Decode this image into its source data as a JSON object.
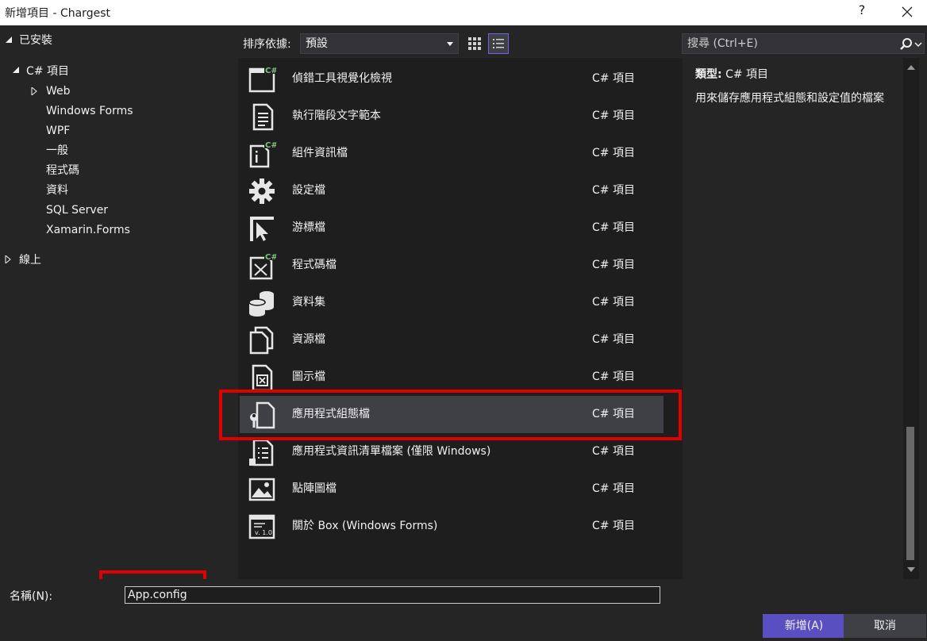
{
  "window": {
    "title": "新增項目 - Chargest",
    "help": "?"
  },
  "tree": {
    "installed": "已安裝",
    "csharp": "C# 項目",
    "children": [
      "Web",
      "Windows Forms",
      "WPF",
      "一般",
      "程式碼",
      "資料",
      "SQL Server",
      "Xamarin.Forms"
    ],
    "online": "線上"
  },
  "toolbar": {
    "sort_label": "排序依據:",
    "sort_value": "預設"
  },
  "search": {
    "placeholder": "搜尋 (Ctrl+E)"
  },
  "items": [
    {
      "name": "偵錯工具視覺化檢視",
      "type": "C# 項目",
      "icon": "visualizer-icon"
    },
    {
      "name": "執行階段文字範本",
      "type": "C# 項目",
      "icon": "text-template-icon"
    },
    {
      "name": "組件資訊檔",
      "type": "C# 項目",
      "icon": "assembly-info-icon"
    },
    {
      "name": "設定檔",
      "type": "C# 項目",
      "icon": "settings-gear-icon"
    },
    {
      "name": "游標檔",
      "type": "C# 項目",
      "icon": "cursor-icon"
    },
    {
      "name": "程式碼檔",
      "type": "C# 項目",
      "icon": "code-file-icon"
    },
    {
      "name": "資料集",
      "type": "C# 項目",
      "icon": "dataset-icon"
    },
    {
      "name": "資源檔",
      "type": "C# 項目",
      "icon": "resource-file-icon"
    },
    {
      "name": "圖示檔",
      "type": "C# 項目",
      "icon": "icon-file-icon"
    },
    {
      "name": "應用程式組態檔",
      "type": "C# 項目",
      "icon": "app-config-icon"
    },
    {
      "name": "應用程式資訊清單檔案 (僅限 Windows)",
      "type": "C# 項目",
      "icon": "manifest-icon"
    },
    {
      "name": "點陣圖檔",
      "type": "C# 項目",
      "icon": "bitmap-icon"
    },
    {
      "name": "關於 Box (Windows Forms)",
      "type": "C# 項目",
      "icon": "about-box-icon"
    }
  ],
  "selected_index": 9,
  "description": {
    "type_label": "類型:",
    "type_value": "C# 項目",
    "text": "用來儲存應用程式組態和設定值的檔案"
  },
  "footer": {
    "name_label": "名稱(N):",
    "name_value": "App.config",
    "add_button": "新增(A)",
    "cancel_button": "取消"
  },
  "colors": {
    "accent": "#5a4fc0",
    "highlight": "#e00000",
    "background": "#252526",
    "list_bg": "#1e1e1e"
  }
}
